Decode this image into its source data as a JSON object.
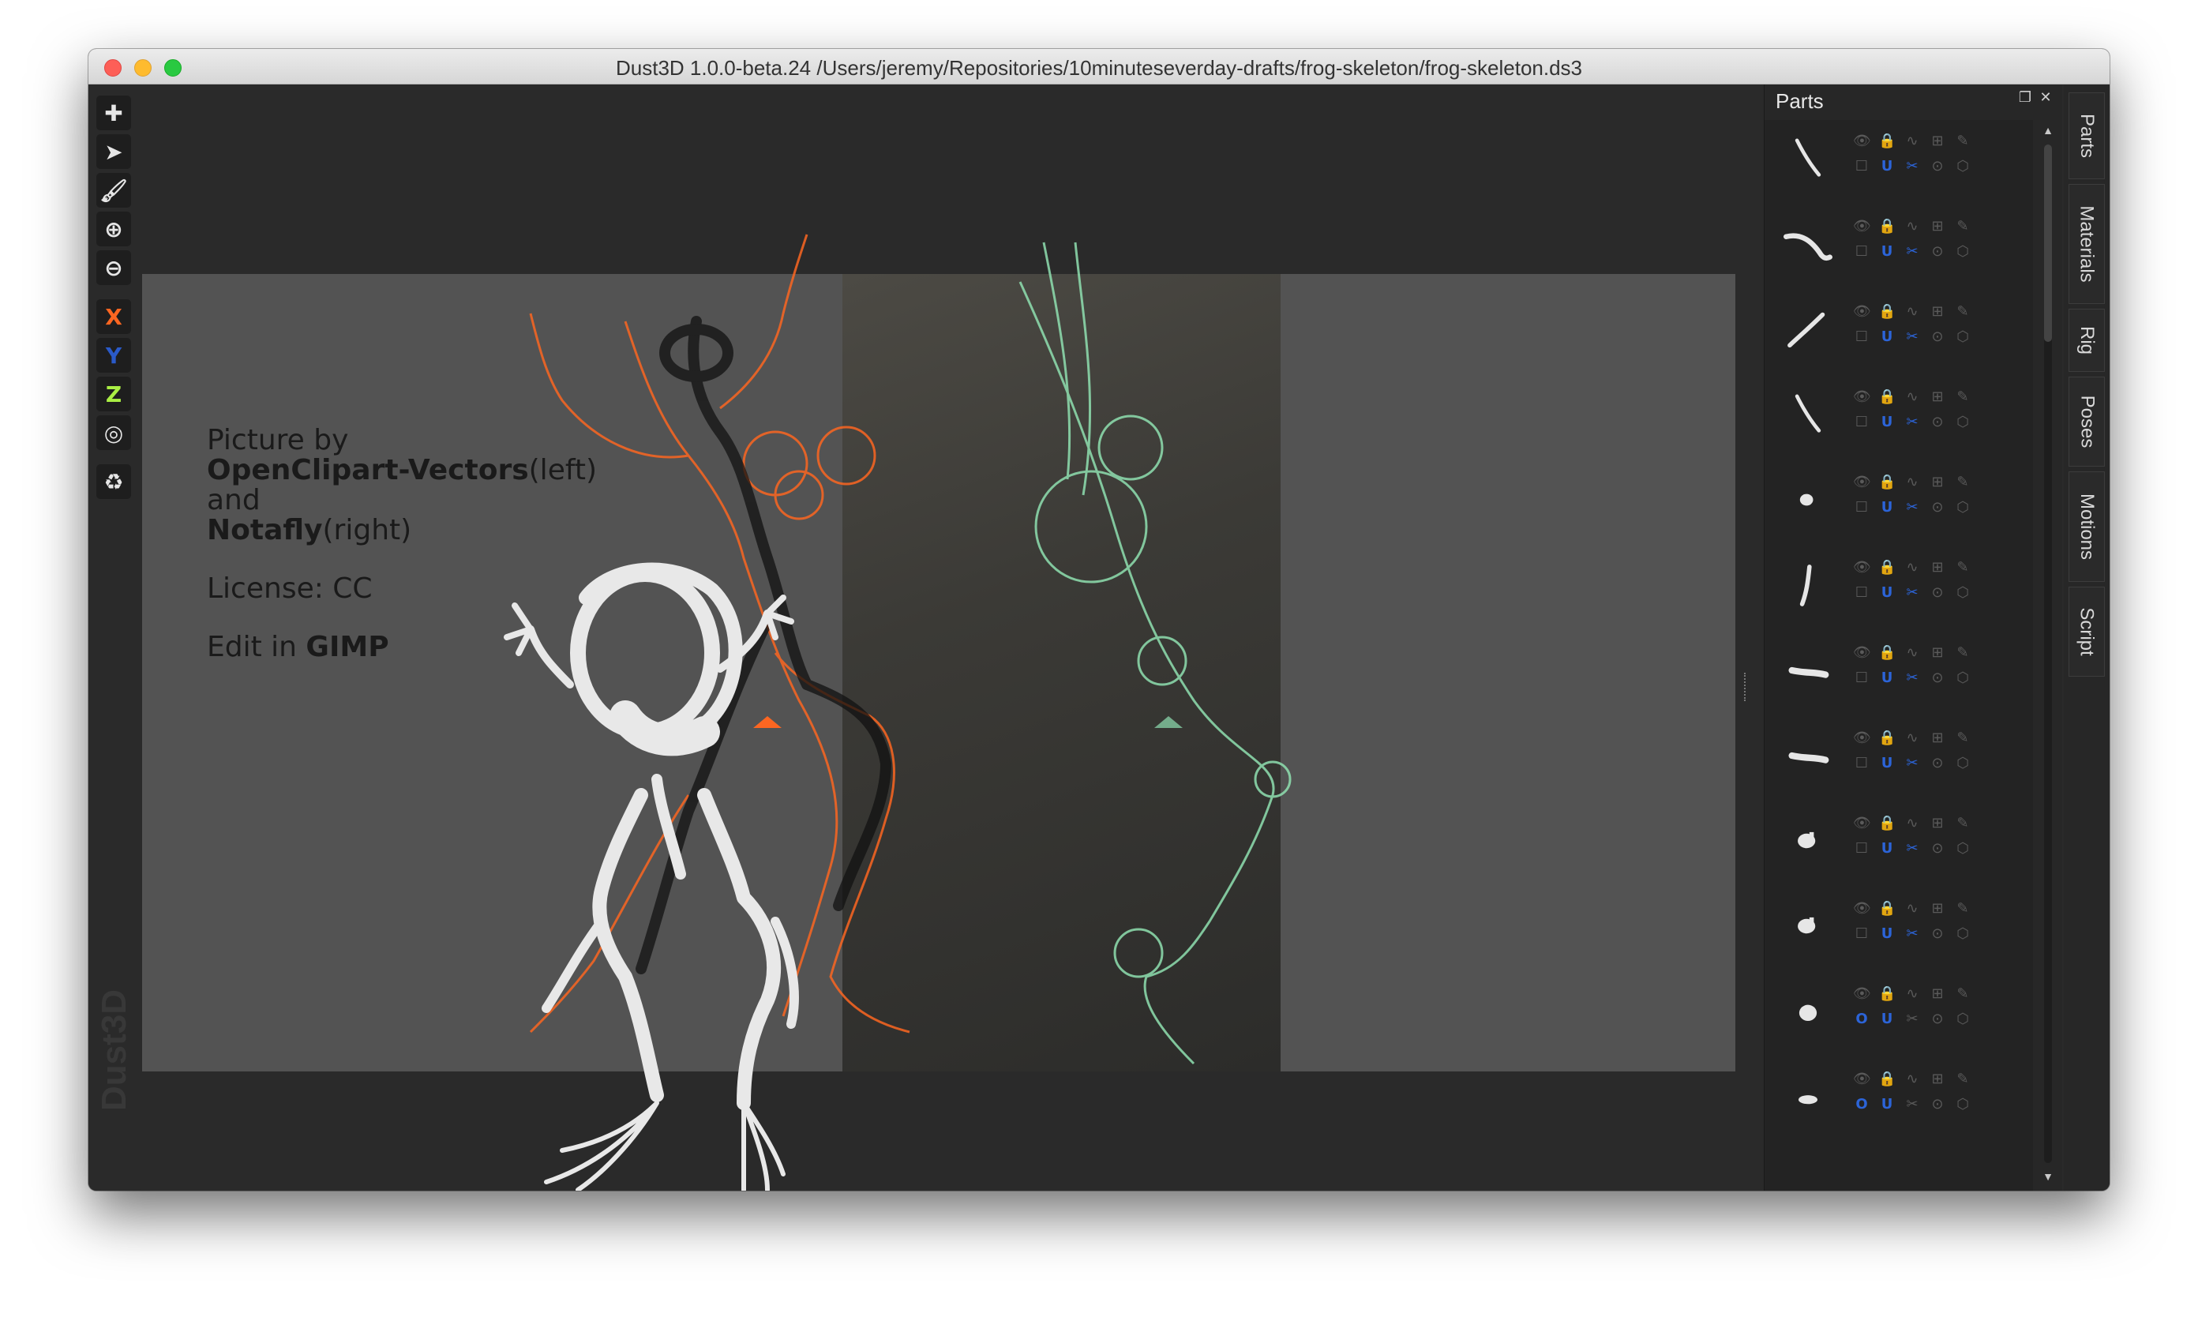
{
  "window": {
    "title": "Dust3D 1.0.0-beta.24 /Users/jeremy/Repositories/10minuteseverday-drafts/frog-skeleton/frog-skeleton.ds3"
  },
  "toolbar": {
    "tools": [
      {
        "name": "add-node-tool",
        "glyph": "✚"
      },
      {
        "name": "select-tool",
        "glyph": "➤"
      },
      {
        "name": "paint-tool",
        "glyph": "🖌"
      },
      {
        "name": "zoom-in-tool",
        "glyph": "⊕"
      },
      {
        "name": "zoom-out-tool",
        "glyph": "⊖"
      }
    ],
    "axis_x": "X",
    "axis_y": "Y",
    "axis_z": "Z",
    "radius_glyph": "◎",
    "regenerate_glyph": "♻"
  },
  "watermark": "Dust3D",
  "reference_credit": {
    "line1": "Picture by",
    "line2_bold": "OpenClipart-Vectors",
    "line2_rest": "(left)",
    "line3": "and",
    "line4_bold": "Notafly",
    "line4_rest": "(right)",
    "license": "License: CC",
    "edit_prefix": "Edit in ",
    "edit_bold": "GIMP"
  },
  "parts_panel": {
    "title": "Parts",
    "float_glyph": "❐",
    "close_glyph": "✕",
    "scroll_up": "▲",
    "scroll_down": "▼",
    "row_glyphs": {
      "visible": "👁",
      "lock": "🔒",
      "subdivide": "∿",
      "mirror": "⊞",
      "edit": "✎",
      "checkbox": "☐",
      "magnet": "U",
      "cut": "✂",
      "xmirror": "⊙",
      "chamfer": "⬡",
      "rounded": "O"
    },
    "parts": [
      {
        "shape": "bone-thin-diag",
        "rounded": false,
        "cut_on": true
      },
      {
        "shape": "bone-curve",
        "rounded": false,
        "cut_on": true
      },
      {
        "shape": "bone-long-diag",
        "rounded": false,
        "cut_on": true
      },
      {
        "shape": "bone-thin-diag",
        "rounded": false,
        "cut_on": true
      },
      {
        "shape": "blob-small",
        "rounded": false,
        "cut_on": true
      },
      {
        "shape": "bone-vertical",
        "rounded": false,
        "cut_on": true
      },
      {
        "shape": "bone-foot",
        "rounded": false,
        "cut_on": true
      },
      {
        "shape": "bone-foot",
        "rounded": false,
        "cut_on": true
      },
      {
        "shape": "blob-knob",
        "rounded": false,
        "cut_on": true
      },
      {
        "shape": "blob-knob",
        "rounded": false,
        "cut_on": true
      },
      {
        "shape": "blob-round",
        "rounded": true,
        "cut_on": false
      },
      {
        "shape": "blob-flat",
        "rounded": true,
        "cut_on": false
      }
    ]
  },
  "side_tabs": [
    "Parts",
    "Materials",
    "Rig",
    "Poses",
    "Motions",
    "Script"
  ],
  "colors": {
    "front_skeleton": "#fc6621",
    "side_skeleton": "#8fe0b0",
    "accent_blue": "#2c64d8",
    "model": "#e8e8e8"
  }
}
